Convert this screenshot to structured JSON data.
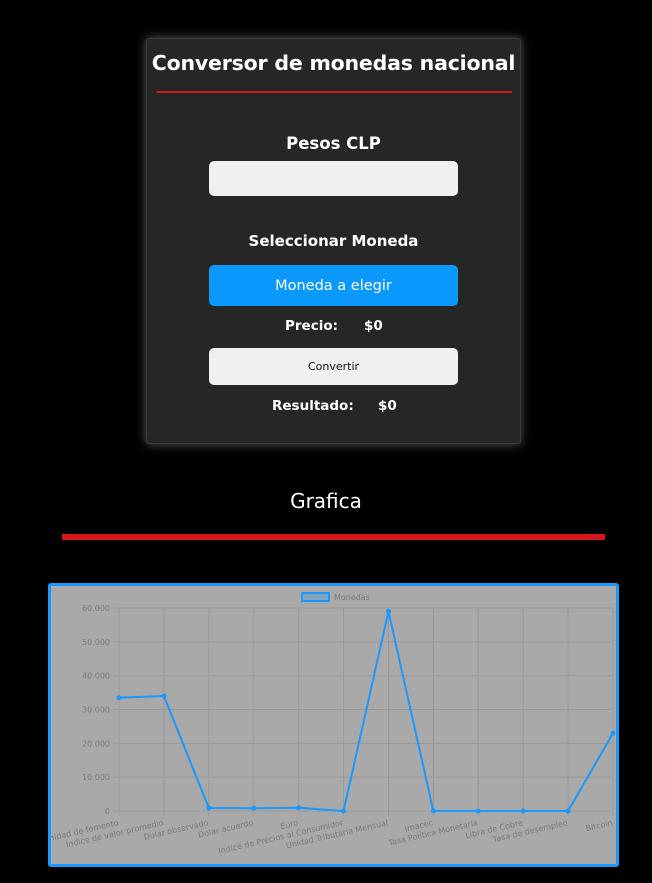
{
  "converter": {
    "title": "Conversor de monedas nacional",
    "clp_label": "Pesos CLP",
    "clp_value": "",
    "select_label": "Seleccionar Moneda",
    "select_button": "Moneda a elegir",
    "price_label": "Precio:",
    "price_value": "$0",
    "convert_button": "Convertir",
    "result_label": "Resultado:",
    "result_value": "$0"
  },
  "section": {
    "title": "Grafica"
  },
  "colors": {
    "accent_red": "#d3171b",
    "accent_blue": "#0b99fd",
    "chart_bg": "#a9a9a9"
  },
  "chart_data": {
    "type": "line",
    "categories": [
      "Unidad de fomento",
      "Indice de valor promedio",
      "Dolar observado",
      "Dolar acuerdo",
      "Euro",
      "Indice de Precios al Consumidor",
      "Unidad Tributaria Mensual",
      "Imacec",
      "Tasa Política Monetaria",
      "Libra de Cobre",
      "Tasa de desempleo",
      "Bitcoin"
    ],
    "series": [
      {
        "name": "Monedas",
        "color": "#1a98fd",
        "values": [
          33500,
          34000,
          900,
          800,
          950,
          0,
          59000,
          0,
          0,
          0,
          0,
          23000
        ]
      }
    ],
    "ylim": [
      0,
      60000
    ],
    "yticks": [
      "0",
      "10.000",
      "20.000",
      "30.000",
      "40.000",
      "50.000",
      "60.000"
    ],
    "grid": true,
    "legend_position": "top"
  }
}
